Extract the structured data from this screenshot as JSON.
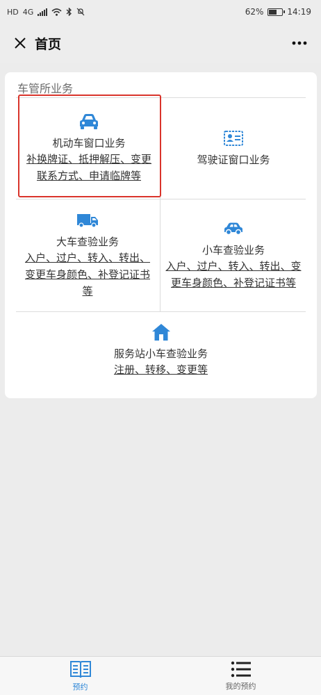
{
  "status_bar": {
    "battery": "62%",
    "battery_level": 0.62,
    "time": "14:19",
    "network": "4G"
  },
  "header": {
    "title": "首页"
  },
  "section": {
    "title": "车管所业务"
  },
  "services": [
    {
      "icon": "car-icon",
      "title": "机动车窗口业务",
      "desc": "补换牌证、抵押解压、变更联系方式、申请临牌等"
    },
    {
      "icon": "license-card-icon",
      "title": "驾驶证窗口业务",
      "desc": ""
    },
    {
      "icon": "truck-icon",
      "title": "大车查验业务",
      "desc": "入户、过户、转入、转出、变更车身颜色、补登记证书等"
    },
    {
      "icon": "small-car-icon",
      "title": "小车查验业务",
      "desc": "入户、过户、转入、转出、变更车身颜色、补登记证书等"
    },
    {
      "icon": "home-icon",
      "title": "服务站小车查验业务",
      "desc": "注册、转移、变更等"
    }
  ],
  "tabs": [
    {
      "label": "预约",
      "icon": "book-icon",
      "active": true
    },
    {
      "label": "我的预约",
      "icon": "list-icon",
      "active": false
    }
  ],
  "colors": {
    "accent": "#2f87d7",
    "highlight": "#d9342b"
  }
}
